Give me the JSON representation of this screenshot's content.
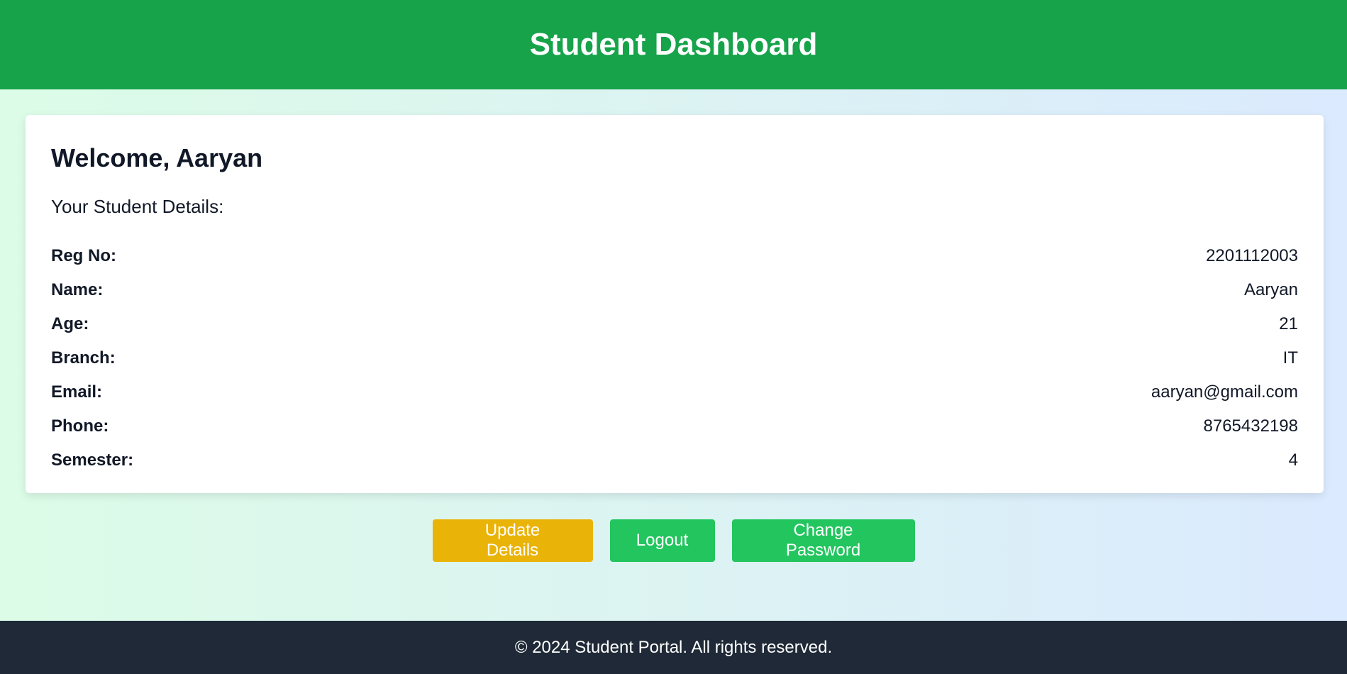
{
  "header": {
    "title": "Student Dashboard"
  },
  "card": {
    "welcome": "Welcome, Aaryan",
    "subtitle": "Your Student Details:",
    "details": [
      {
        "label": "Reg No:",
        "value": "2201112003"
      },
      {
        "label": "Name:",
        "value": "Aaryan"
      },
      {
        "label": "Age:",
        "value": "21"
      },
      {
        "label": "Branch:",
        "value": "IT"
      },
      {
        "label": "Email:",
        "value": "aaryan@gmail.com"
      },
      {
        "label": "Phone:",
        "value": "8765432198"
      },
      {
        "label": "Semester:",
        "value": "4"
      }
    ]
  },
  "actions": {
    "update_label": "Update Details",
    "logout_label": "Logout",
    "change_password_label": "Change Password"
  },
  "footer": {
    "text": "© 2024 Student Portal. All rights reserved."
  },
  "colors": {
    "header": "#16a34a",
    "update_button": "#eab308",
    "primary_button": "#22c55e",
    "footer": "#1f2937"
  }
}
